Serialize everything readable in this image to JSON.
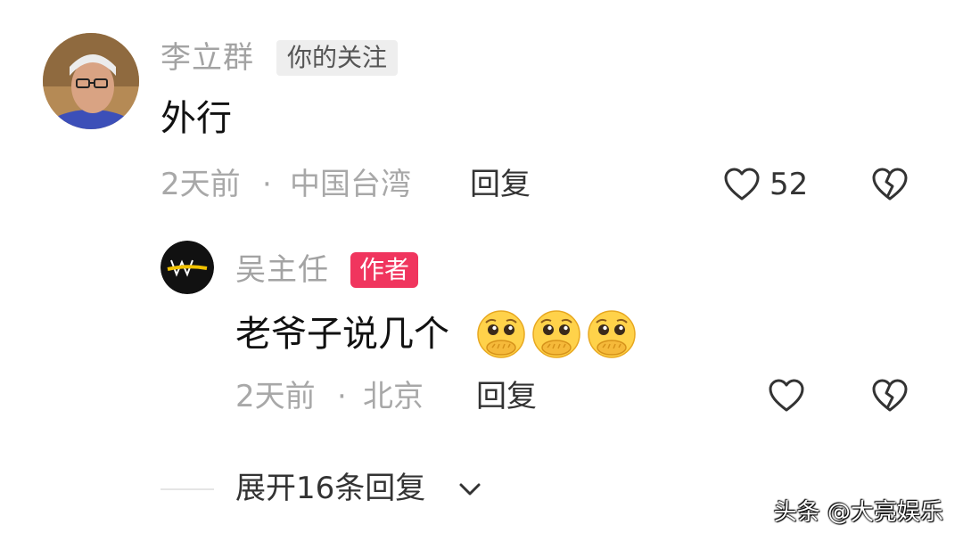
{
  "comment": {
    "username": "李立群",
    "follow_tag": "你的关注",
    "text": "外行",
    "time": "2天前",
    "separator": "·",
    "location": "中国台湾",
    "reply_label": "回复",
    "like_count": "52"
  },
  "reply": {
    "username": "吴主任",
    "author_tag": "作者",
    "text": "老爷子说几个",
    "emoji_count": 3,
    "time": "2天前",
    "separator": "·",
    "location": "北京",
    "reply_label": "回复"
  },
  "expand": {
    "label": "展开16条回复"
  },
  "watermark": "头条 @大亮娱乐",
  "icons": {
    "like": "heart-outline-icon",
    "dislike": "broken-heart-icon",
    "expand": "chevron-down-icon"
  },
  "colors": {
    "author_tag_bg": "#f0355e",
    "follow_tag_bg": "#eeeeee",
    "meta_text": "#a8a8a8"
  }
}
